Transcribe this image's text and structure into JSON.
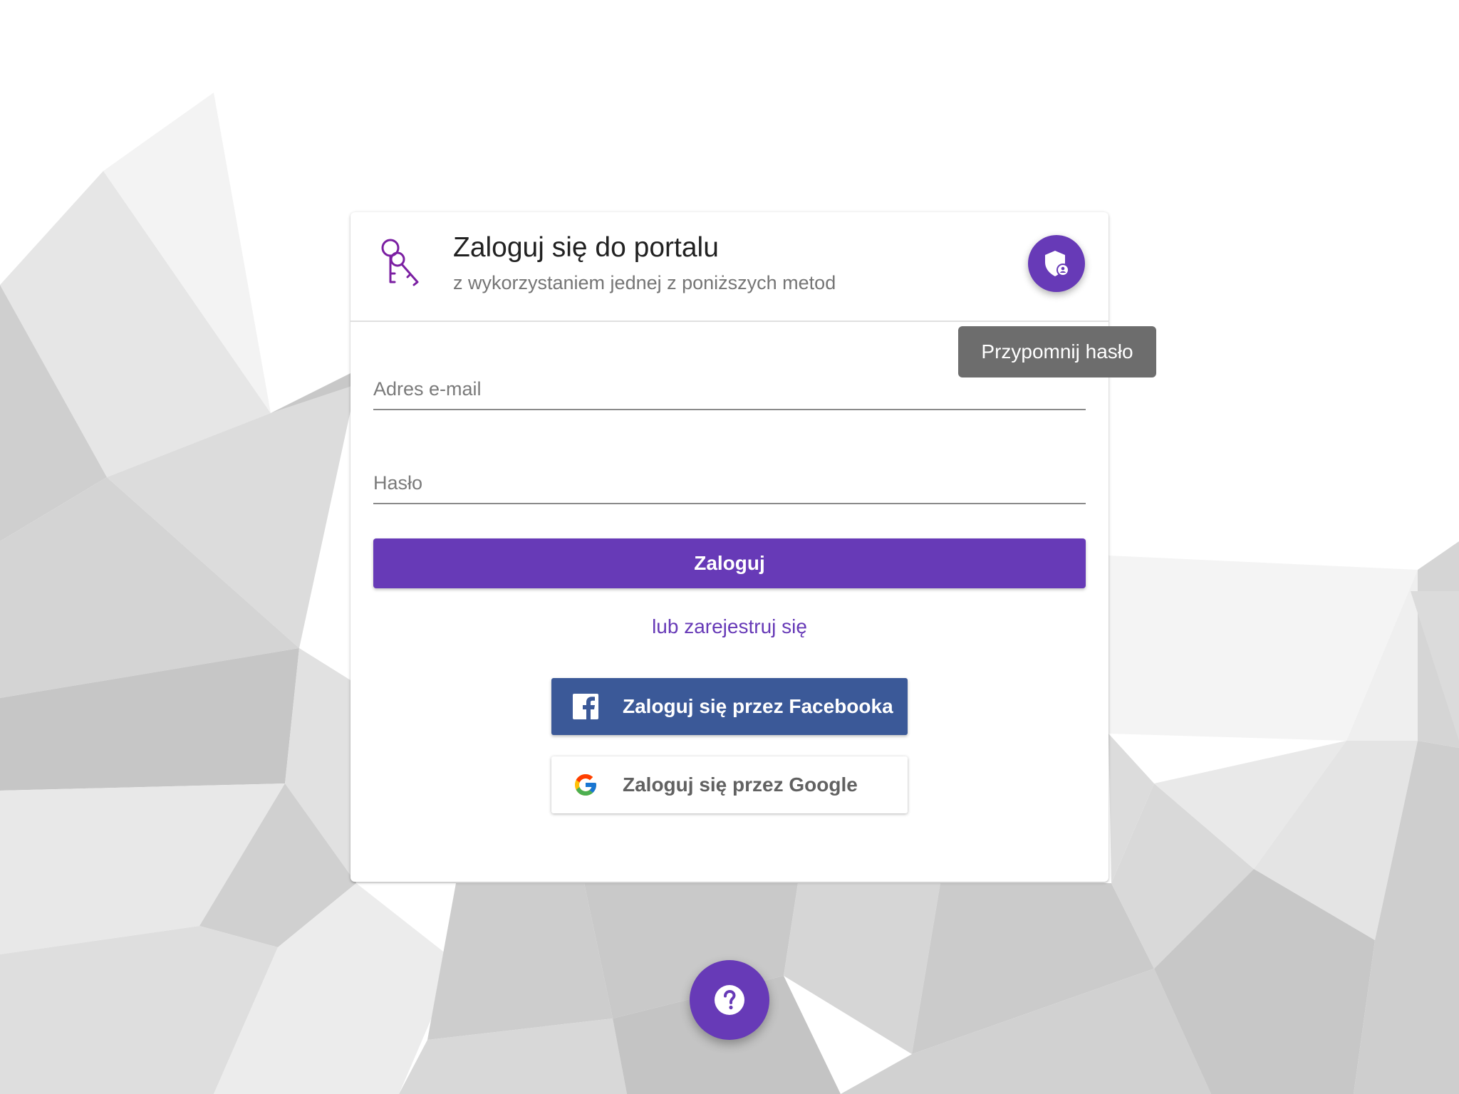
{
  "login": {
    "title": "Zaloguj się do portalu",
    "subtitle": "z wykorzystaniem jednej z poniższych metod",
    "remind_tooltip": "Przypomnij hasło",
    "email_placeholder": "Adres e-mail",
    "password_placeholder": "Hasło",
    "login_button": "Zaloguj",
    "register_link": "lub zarejestruj się",
    "facebook_button": "Zaloguj się przez Facebooka",
    "google_button": "Zaloguj się przez Google"
  },
  "icons": {
    "header": "keys-icon",
    "remind": "shield-account-icon",
    "facebook": "facebook-icon",
    "google": "google-icon",
    "help": "help-icon"
  },
  "colors": {
    "primary": "#673ab7",
    "facebook": "#3b5998",
    "tooltip": "#6d6d6d"
  }
}
